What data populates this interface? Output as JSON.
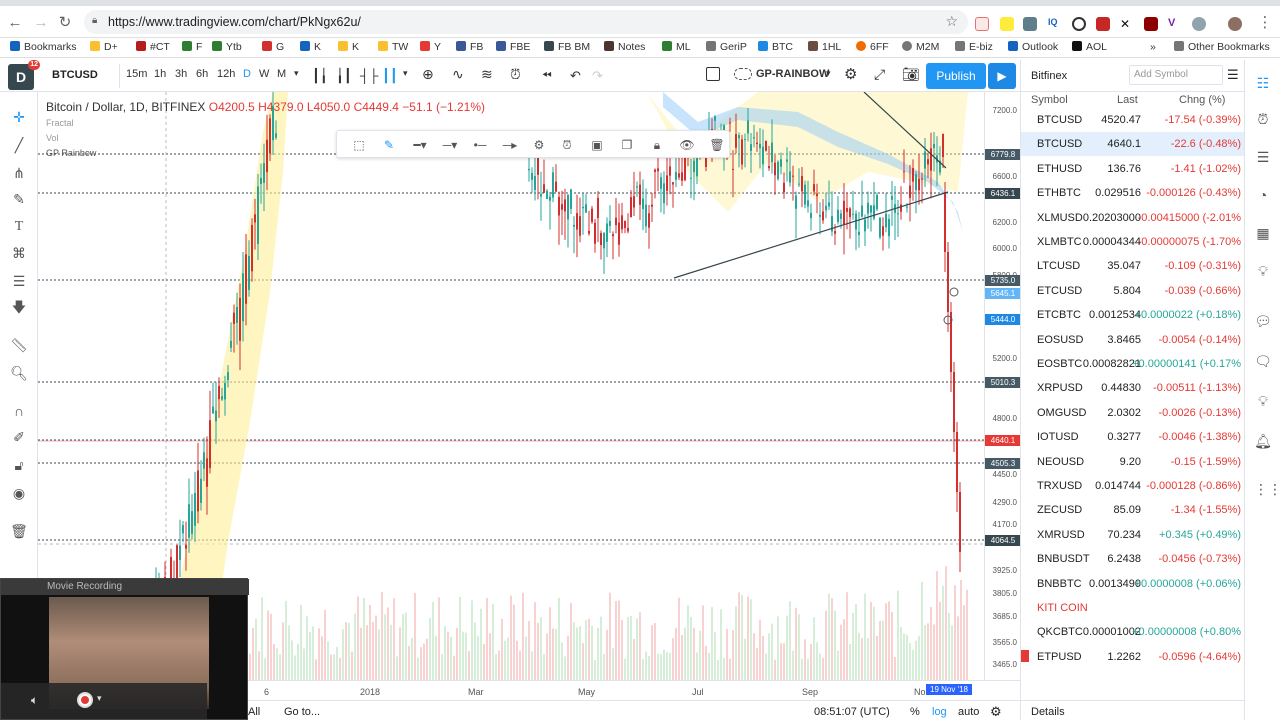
{
  "browser": {
    "url": "https://www.tradingview.com/chart/PkNgx62u/",
    "bookmarks": [
      "Bookmarks",
      "D+",
      "#CT",
      "F",
      "Ytb",
      "G",
      "K",
      "K",
      "TW",
      "Y",
      "FB",
      "FBE",
      "FB BM",
      "Notes",
      "ML",
      "GeriP",
      "BTC",
      "1HL",
      "6FF",
      "M2M",
      "E-biz",
      "Outlook",
      "AOL"
    ],
    "other_bookmarks": "Other Bookmarks",
    "bookmarks_more": "»"
  },
  "toolbar": {
    "logo_badge": "12",
    "symbol": "BTCUSD",
    "intervals": [
      "15m",
      "1h",
      "3h",
      "6h",
      "12h",
      "D",
      "W",
      "M"
    ],
    "template": "GP-RAINBOW",
    "publish_label": "Publish"
  },
  "legend": {
    "title": "Bitcoin / Dollar, 1D, BITFINEX",
    "o": "4200.5",
    "h_label": "H",
    "h": "4379.0",
    "l_label": "L",
    "l": "4050.0",
    "c_label": "C",
    "c": "4449.4",
    "change": "−51.1 (−1.21%)",
    "ind1": "Fractal",
    "ind2": "Vol",
    "ind3": "GP Rainbow"
  },
  "price_scale": {
    "ticks": [
      "7200.0",
      "6600.0",
      "6200.0",
      "6000.0",
      "5800.0",
      "5200.0",
      "4800.0",
      "4450.0",
      "4290.0",
      "4170.0",
      "3925.0",
      "3805.0",
      "3685.0",
      "3565.0",
      "3465.0"
    ],
    "boxes": [
      {
        "value": "6779.8",
        "color": "#455a64"
      },
      {
        "value": "6436.1",
        "color": "#37474f"
      },
      {
        "value": "5735.0",
        "color": "#455a64"
      },
      {
        "value": "5645.1",
        "color": "#64b5f6"
      },
      {
        "value": "5444.0",
        "color": "#1e88e5"
      },
      {
        "value": "5010.3",
        "color": "#455a64"
      },
      {
        "value": "4640.1",
        "color": "#e53935"
      },
      {
        "value": "4505.3",
        "color": "#455a64"
      },
      {
        "value": "4064.5",
        "color": "#37474f"
      }
    ]
  },
  "time_scale": {
    "labels": [
      "6",
      "2018",
      "Mar",
      "May",
      "Jul",
      "Sep",
      "No"
    ],
    "cursor_date": "19 Nov '18"
  },
  "bottom": {
    "all": "All",
    "goto": "Go to...",
    "time": "08:51:07 (UTC)",
    "percent": "%",
    "log": "log",
    "auto": "auto"
  },
  "watchlist": {
    "exchange": "Bitfinex",
    "add_symbol": "Add Symbol",
    "col_symbol": "Symbol",
    "col_last": "Last",
    "col_change": "Chng (%)",
    "rows": [
      {
        "sym": "BTCUSD",
        "last": "4520.47",
        "chg": "-17.54 (-0.39%)",
        "dir": "neg"
      },
      {
        "sym": "BTCUSD",
        "last": "4640.1",
        "chg": "-22.6 (-0.48%)",
        "dir": "neg"
      },
      {
        "sym": "ETHUSD",
        "last": "136.76",
        "chg": "-1.41 (-1.02%)",
        "dir": "neg"
      },
      {
        "sym": "ETHBTC",
        "last": "0.029516",
        "chg": "-0.000126 (-0.43%)",
        "dir": "neg"
      },
      {
        "sym": "XLMUSD",
        "last": "0.20203000",
        "chg": "-0.00415000 (-2.01%",
        "dir": "neg"
      },
      {
        "sym": "XLMBTC",
        "last": "0.00004344",
        "chg": "-0.00000075 (-1.70%",
        "dir": "neg"
      },
      {
        "sym": "LTCUSD",
        "last": "35.047",
        "chg": "-0.109 (-0.31%)",
        "dir": "neg"
      },
      {
        "sym": "ETCUSD",
        "last": "5.804",
        "chg": "-0.039 (-0.66%)",
        "dir": "neg"
      },
      {
        "sym": "ETCBTC",
        "last": "0.0012534",
        "chg": "+0.0000022 (+0.18%)",
        "dir": "pos"
      },
      {
        "sym": "EOSUSD",
        "last": "3.8465",
        "chg": "-0.0054 (-0.14%)",
        "dir": "neg"
      },
      {
        "sym": "EOSBTC",
        "last": "0.00082821",
        "chg": "+0.00000141 (+0.17%",
        "dir": "pos"
      },
      {
        "sym": "XRPUSD",
        "last": "0.44830",
        "chg": "-0.00511 (-1.13%)",
        "dir": "neg"
      },
      {
        "sym": "OMGUSD",
        "last": "2.0302",
        "chg": "-0.0026 (-0.13%)",
        "dir": "neg"
      },
      {
        "sym": "IOTUSD",
        "last": "0.3277",
        "chg": "-0.0046 (-1.38%)",
        "dir": "neg"
      },
      {
        "sym": "NEOUSD",
        "last": "9.20",
        "chg": "-0.15 (-1.59%)",
        "dir": "neg"
      },
      {
        "sym": "TRXUSD",
        "last": "0.014744",
        "chg": "-0.000128 (-0.86%)",
        "dir": "neg"
      },
      {
        "sym": "ZECUSD",
        "last": "85.09",
        "chg": "-1.34 (-1.55%)",
        "dir": "neg"
      },
      {
        "sym": "XMRUSD",
        "last": "70.234",
        "chg": "+0.345 (+0.49%)",
        "dir": "pos"
      },
      {
        "sym": "BNBUSDT",
        "last": "6.2438",
        "chg": "-0.0456 (-0.73%)",
        "dir": "neg"
      },
      {
        "sym": "BNBBTC",
        "last": "0.0013490",
        "chg": "+0.0000008 (+0.06%)",
        "dir": "pos"
      },
      {
        "sym": "KITI COIN",
        "last": "",
        "chg": "",
        "dir": "section"
      },
      {
        "sym": "QKCBTC",
        "last": "0.00001002",
        "chg": "+0.00000008 (+0.80%",
        "dir": "pos"
      },
      {
        "sym": "ETPUSD",
        "last": "1.2262",
        "chg": "-0.0596 (-4.64%)",
        "dir": "neg"
      }
    ],
    "details": "Details"
  },
  "movie": {
    "title": "Movie Recording"
  }
}
